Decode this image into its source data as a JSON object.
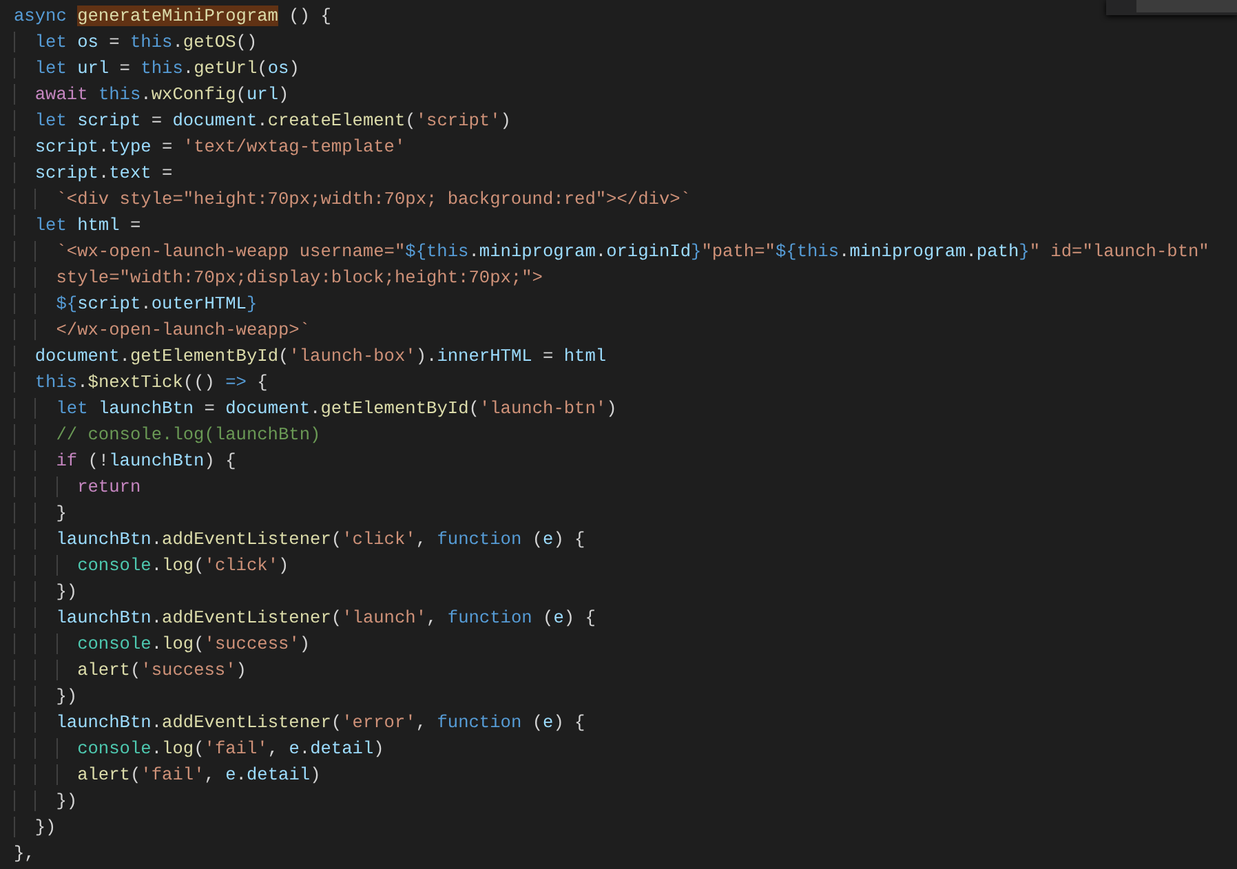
{
  "editor": {
    "lines": [
      {
        "tokens": [
          {
            "kind": "keyword",
            "text": "async "
          },
          {
            "kind": "function",
            "text": "generateMiniProgram",
            "highlighted": true
          },
          {
            "kind": "plain",
            "text": " () {"
          }
        ]
      },
      {
        "tokens": [
          {
            "kind": "keyword",
            "text": "  let "
          },
          {
            "kind": "variable",
            "text": "os"
          },
          {
            "kind": "plain",
            "text": " = "
          },
          {
            "kind": "keyword",
            "text": "this"
          },
          {
            "kind": "plain",
            "text": "."
          },
          {
            "kind": "function",
            "text": "getOS"
          },
          {
            "kind": "plain",
            "text": "()"
          }
        ]
      },
      {
        "tokens": [
          {
            "kind": "keyword",
            "text": "  let "
          },
          {
            "kind": "variable",
            "text": "url"
          },
          {
            "kind": "plain",
            "text": " = "
          },
          {
            "kind": "keyword",
            "text": "this"
          },
          {
            "kind": "plain",
            "text": "."
          },
          {
            "kind": "function",
            "text": "getUrl"
          },
          {
            "kind": "plain",
            "text": "("
          },
          {
            "kind": "variable",
            "text": "os"
          },
          {
            "kind": "plain",
            "text": ")"
          }
        ]
      },
      {
        "tokens": [
          {
            "kind": "control",
            "text": "  await "
          },
          {
            "kind": "keyword",
            "text": "this"
          },
          {
            "kind": "plain",
            "text": "."
          },
          {
            "kind": "function",
            "text": "wxConfig"
          },
          {
            "kind": "plain",
            "text": "("
          },
          {
            "kind": "variable",
            "text": "url"
          },
          {
            "kind": "plain",
            "text": ")"
          }
        ]
      },
      {
        "tokens": [
          {
            "kind": "keyword",
            "text": "  let "
          },
          {
            "kind": "variable",
            "text": "script"
          },
          {
            "kind": "plain",
            "text": " = "
          },
          {
            "kind": "variable",
            "text": "document"
          },
          {
            "kind": "plain",
            "text": "."
          },
          {
            "kind": "function",
            "text": "createElement"
          },
          {
            "kind": "plain",
            "text": "("
          },
          {
            "kind": "string",
            "text": "'script'"
          },
          {
            "kind": "plain",
            "text": ")"
          }
        ]
      },
      {
        "tokens": [
          {
            "kind": "variable",
            "text": "  script"
          },
          {
            "kind": "plain",
            "text": "."
          },
          {
            "kind": "variable",
            "text": "type"
          },
          {
            "kind": "plain",
            "text": " = "
          },
          {
            "kind": "string",
            "text": "'text/wxtag-template'"
          }
        ]
      },
      {
        "tokens": [
          {
            "kind": "variable",
            "text": "  script"
          },
          {
            "kind": "plain",
            "text": "."
          },
          {
            "kind": "variable",
            "text": "text"
          },
          {
            "kind": "plain",
            "text": " ="
          }
        ]
      },
      {
        "tokens": [
          {
            "kind": "string",
            "text": "    `<div style=\"height:70px;width:70px; background:red\"></div>`"
          }
        ]
      },
      {
        "tokens": [
          {
            "kind": "keyword",
            "text": "  let "
          },
          {
            "kind": "variable",
            "text": "html"
          },
          {
            "kind": "plain",
            "text": " ="
          }
        ]
      },
      {
        "tokens": [
          {
            "kind": "string",
            "text": "    `<wx-open-launch-weapp username=\""
          },
          {
            "kind": "keyword",
            "text": "${"
          },
          {
            "kind": "keyword",
            "text": "this"
          },
          {
            "kind": "plain",
            "text": "."
          },
          {
            "kind": "variable",
            "text": "miniprogram"
          },
          {
            "kind": "plain",
            "text": "."
          },
          {
            "kind": "variable",
            "text": "originId"
          },
          {
            "kind": "keyword",
            "text": "}"
          },
          {
            "kind": "string",
            "text": "\"path=\""
          },
          {
            "kind": "keyword",
            "text": "${"
          },
          {
            "kind": "keyword",
            "text": "this"
          },
          {
            "kind": "plain",
            "text": "."
          },
          {
            "kind": "variable",
            "text": "miniprogram"
          },
          {
            "kind": "plain",
            "text": "."
          },
          {
            "kind": "variable",
            "text": "path"
          },
          {
            "kind": "keyword",
            "text": "}"
          },
          {
            "kind": "string",
            "text": "\" id=\"launch-btn\""
          }
        ]
      },
      {
        "tokens": [
          {
            "kind": "string",
            "text": "    style=\"width:70px;display:block;height:70px;\">"
          }
        ]
      },
      {
        "tokens": [
          {
            "kind": "keyword",
            "text": "    ${"
          },
          {
            "kind": "variable",
            "text": "script"
          },
          {
            "kind": "plain",
            "text": "."
          },
          {
            "kind": "variable",
            "text": "outerHTML"
          },
          {
            "kind": "keyword",
            "text": "}"
          }
        ]
      },
      {
        "tokens": [
          {
            "kind": "string",
            "text": "    </wx-open-launch-weapp>`"
          }
        ]
      },
      {
        "tokens": [
          {
            "kind": "variable",
            "text": "  document"
          },
          {
            "kind": "plain",
            "text": "."
          },
          {
            "kind": "function",
            "text": "getElementById"
          },
          {
            "kind": "plain",
            "text": "("
          },
          {
            "kind": "string",
            "text": "'launch-box'"
          },
          {
            "kind": "plain",
            "text": ")."
          },
          {
            "kind": "variable",
            "text": "innerHTML"
          },
          {
            "kind": "plain",
            "text": " = "
          },
          {
            "kind": "variable",
            "text": "html"
          }
        ]
      },
      {
        "tokens": [
          {
            "kind": "keyword",
            "text": "  this"
          },
          {
            "kind": "plain",
            "text": "."
          },
          {
            "kind": "function",
            "text": "$nextTick"
          },
          {
            "kind": "plain",
            "text": "(() "
          },
          {
            "kind": "keyword",
            "text": "=>"
          },
          {
            "kind": "plain",
            "text": " {"
          }
        ]
      },
      {
        "tokens": [
          {
            "kind": "keyword",
            "text": "    let "
          },
          {
            "kind": "variable",
            "text": "launchBtn"
          },
          {
            "kind": "plain",
            "text": " = "
          },
          {
            "kind": "variable",
            "text": "document"
          },
          {
            "kind": "plain",
            "text": "."
          },
          {
            "kind": "function",
            "text": "getElementById"
          },
          {
            "kind": "plain",
            "text": "("
          },
          {
            "kind": "string",
            "text": "'launch-btn'"
          },
          {
            "kind": "plain",
            "text": ")"
          }
        ]
      },
      {
        "tokens": [
          {
            "kind": "comment",
            "text": "    // console.log(launchBtn)"
          }
        ]
      },
      {
        "tokens": [
          {
            "kind": "control",
            "text": "    if"
          },
          {
            "kind": "plain",
            "text": " (!"
          },
          {
            "kind": "variable",
            "text": "launchBtn"
          },
          {
            "kind": "plain",
            "text": ") {"
          }
        ]
      },
      {
        "tokens": [
          {
            "kind": "control",
            "text": "      return"
          }
        ]
      },
      {
        "tokens": [
          {
            "kind": "plain",
            "text": "    }"
          }
        ]
      },
      {
        "tokens": [
          {
            "kind": "variable",
            "text": "    launchBtn"
          },
          {
            "kind": "plain",
            "text": "."
          },
          {
            "kind": "function",
            "text": "addEventListener"
          },
          {
            "kind": "plain",
            "text": "("
          },
          {
            "kind": "string",
            "text": "'click'"
          },
          {
            "kind": "plain",
            "text": ", "
          },
          {
            "kind": "keyword",
            "text": "function"
          },
          {
            "kind": "plain",
            "text": " ("
          },
          {
            "kind": "variable",
            "text": "e"
          },
          {
            "kind": "plain",
            "text": ") {"
          }
        ]
      },
      {
        "tokens": [
          {
            "kind": "class",
            "text": "      console"
          },
          {
            "kind": "plain",
            "text": "."
          },
          {
            "kind": "function",
            "text": "log"
          },
          {
            "kind": "plain",
            "text": "("
          },
          {
            "kind": "string",
            "text": "'click'"
          },
          {
            "kind": "plain",
            "text": ")"
          }
        ]
      },
      {
        "tokens": [
          {
            "kind": "plain",
            "text": "    })"
          }
        ]
      },
      {
        "tokens": [
          {
            "kind": "variable",
            "text": "    launchBtn"
          },
          {
            "kind": "plain",
            "text": "."
          },
          {
            "kind": "function",
            "text": "addEventListener"
          },
          {
            "kind": "plain",
            "text": "("
          },
          {
            "kind": "string",
            "text": "'launch'"
          },
          {
            "kind": "plain",
            "text": ", "
          },
          {
            "kind": "keyword",
            "text": "function"
          },
          {
            "kind": "plain",
            "text": " ("
          },
          {
            "kind": "variable",
            "text": "e"
          },
          {
            "kind": "plain",
            "text": ") {"
          }
        ]
      },
      {
        "tokens": [
          {
            "kind": "class",
            "text": "      console"
          },
          {
            "kind": "plain",
            "text": "."
          },
          {
            "kind": "function",
            "text": "log"
          },
          {
            "kind": "plain",
            "text": "("
          },
          {
            "kind": "string",
            "text": "'success'"
          },
          {
            "kind": "plain",
            "text": ")"
          }
        ]
      },
      {
        "tokens": [
          {
            "kind": "function",
            "text": "      alert"
          },
          {
            "kind": "plain",
            "text": "("
          },
          {
            "kind": "string",
            "text": "'success'"
          },
          {
            "kind": "plain",
            "text": ")"
          }
        ]
      },
      {
        "tokens": [
          {
            "kind": "plain",
            "text": "    })"
          }
        ]
      },
      {
        "tokens": [
          {
            "kind": "variable",
            "text": "    launchBtn"
          },
          {
            "kind": "plain",
            "text": "."
          },
          {
            "kind": "function",
            "text": "addEventListener"
          },
          {
            "kind": "plain",
            "text": "("
          },
          {
            "kind": "string",
            "text": "'error'"
          },
          {
            "kind": "plain",
            "text": ", "
          },
          {
            "kind": "keyword",
            "text": "function"
          },
          {
            "kind": "plain",
            "text": " ("
          },
          {
            "kind": "variable",
            "text": "e"
          },
          {
            "kind": "plain",
            "text": ") {"
          }
        ]
      },
      {
        "tokens": [
          {
            "kind": "class",
            "text": "      console"
          },
          {
            "kind": "plain",
            "text": "."
          },
          {
            "kind": "function",
            "text": "log"
          },
          {
            "kind": "plain",
            "text": "("
          },
          {
            "kind": "string",
            "text": "'fail'"
          },
          {
            "kind": "plain",
            "text": ", "
          },
          {
            "kind": "variable",
            "text": "e"
          },
          {
            "kind": "plain",
            "text": "."
          },
          {
            "kind": "variable",
            "text": "detail"
          },
          {
            "kind": "plain",
            "text": ")"
          }
        ]
      },
      {
        "tokens": [
          {
            "kind": "function",
            "text": "      alert"
          },
          {
            "kind": "plain",
            "text": "("
          },
          {
            "kind": "string",
            "text": "'fail'"
          },
          {
            "kind": "plain",
            "text": ", "
          },
          {
            "kind": "variable",
            "text": "e"
          },
          {
            "kind": "plain",
            "text": "."
          },
          {
            "kind": "variable",
            "text": "detail"
          },
          {
            "kind": "plain",
            "text": ")"
          }
        ]
      },
      {
        "tokens": [
          {
            "kind": "plain",
            "text": "    })"
          }
        ]
      },
      {
        "tokens": [
          {
            "kind": "plain",
            "text": "  })"
          }
        ]
      },
      {
        "tokens": [
          {
            "kind": "plain",
            "text": "},"
          }
        ]
      }
    ]
  }
}
